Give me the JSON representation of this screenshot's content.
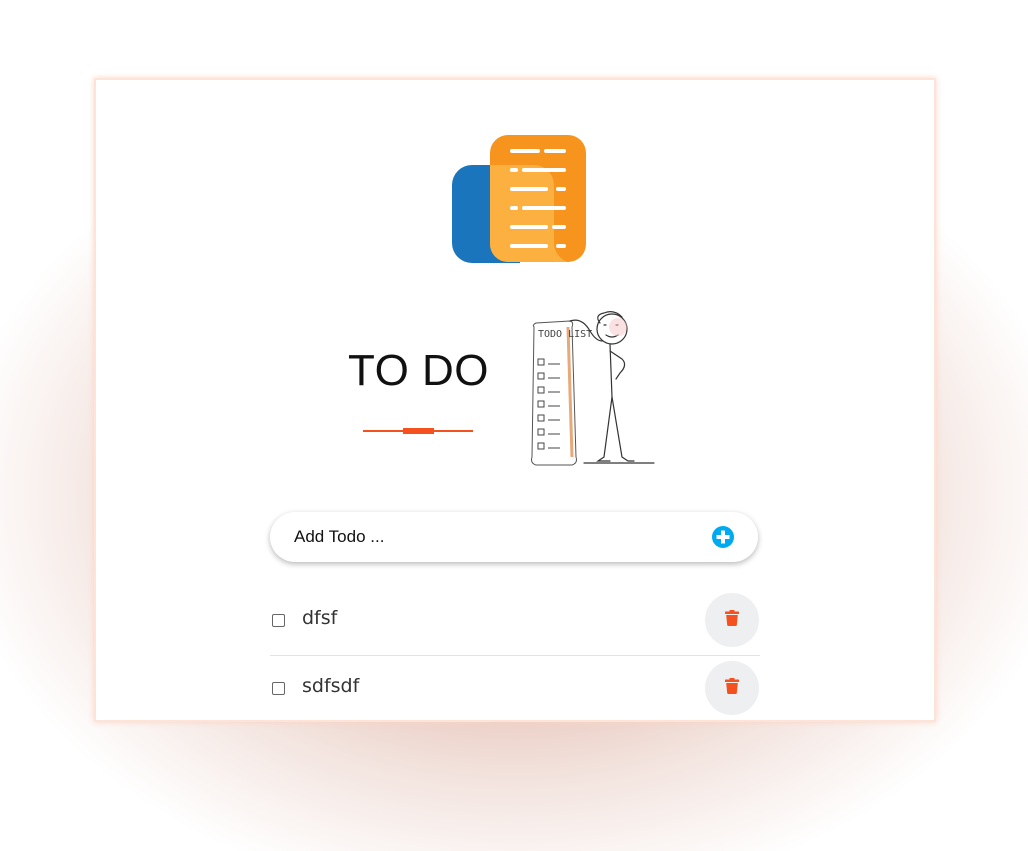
{
  "app": {
    "title": "TO DO",
    "illustration_text": "TODO LIST"
  },
  "add_todo": {
    "placeholder": "Add Todo ..."
  },
  "todos": [
    {
      "text": "dfsf",
      "done": false
    },
    {
      "text": "sdfsdf",
      "done": false
    }
  ],
  "colors": {
    "accent": "#f4511e",
    "add_button": "#00aaf0",
    "logo_orange": "#f7941d",
    "logo_blue": "#1b75bc",
    "delete_bg": "#eeeff1"
  },
  "icons": {
    "logo": "notes-logo-icon",
    "add": "plus-circle-icon",
    "delete": "trash-icon"
  }
}
